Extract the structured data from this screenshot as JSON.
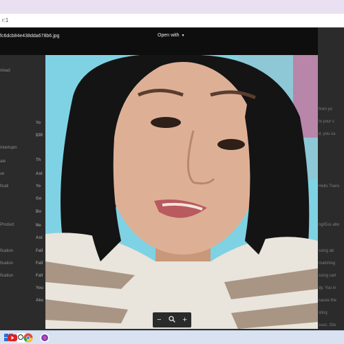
{
  "browser": {
    "address_text": "r:1"
  },
  "viewer": {
    "file_name": "fc6dcb84e438dda678b6.jpg",
    "open_with_label": "Open with",
    "zoom": {
      "out": "−",
      "in": "+"
    }
  },
  "background": {
    "left_items": [
      "nload",
      "Interlopin",
      "ate",
      "ve",
      "ficati",
      "Product",
      "fication",
      "fication",
      "fication"
    ],
    "mid_items": [
      "Yo",
      "$30",
      "Th",
      "Ast",
      "Yo",
      "Go",
      "Bo",
      "Ne",
      "Ast",
      "Fall",
      "Fall",
      "Fall",
      "You",
      "Aks"
    ],
    "right_items": [
      "from yo",
      "to your s",
      "d, you ca",
      "Hello Trans",
      "ng/Eus abo",
      "ssing ab",
      "matching",
      "ssing cart",
      "dy. You in",
      "cause the",
      "sting",
      "ssoc, Oto"
    ],
    "panel_label": "x"
  },
  "taskbar": {
    "icons": [
      "windows-icon",
      "search-icon",
      "task-view-icon",
      "youtube-icon",
      "google-icon",
      "chrome-icon"
    ]
  }
}
